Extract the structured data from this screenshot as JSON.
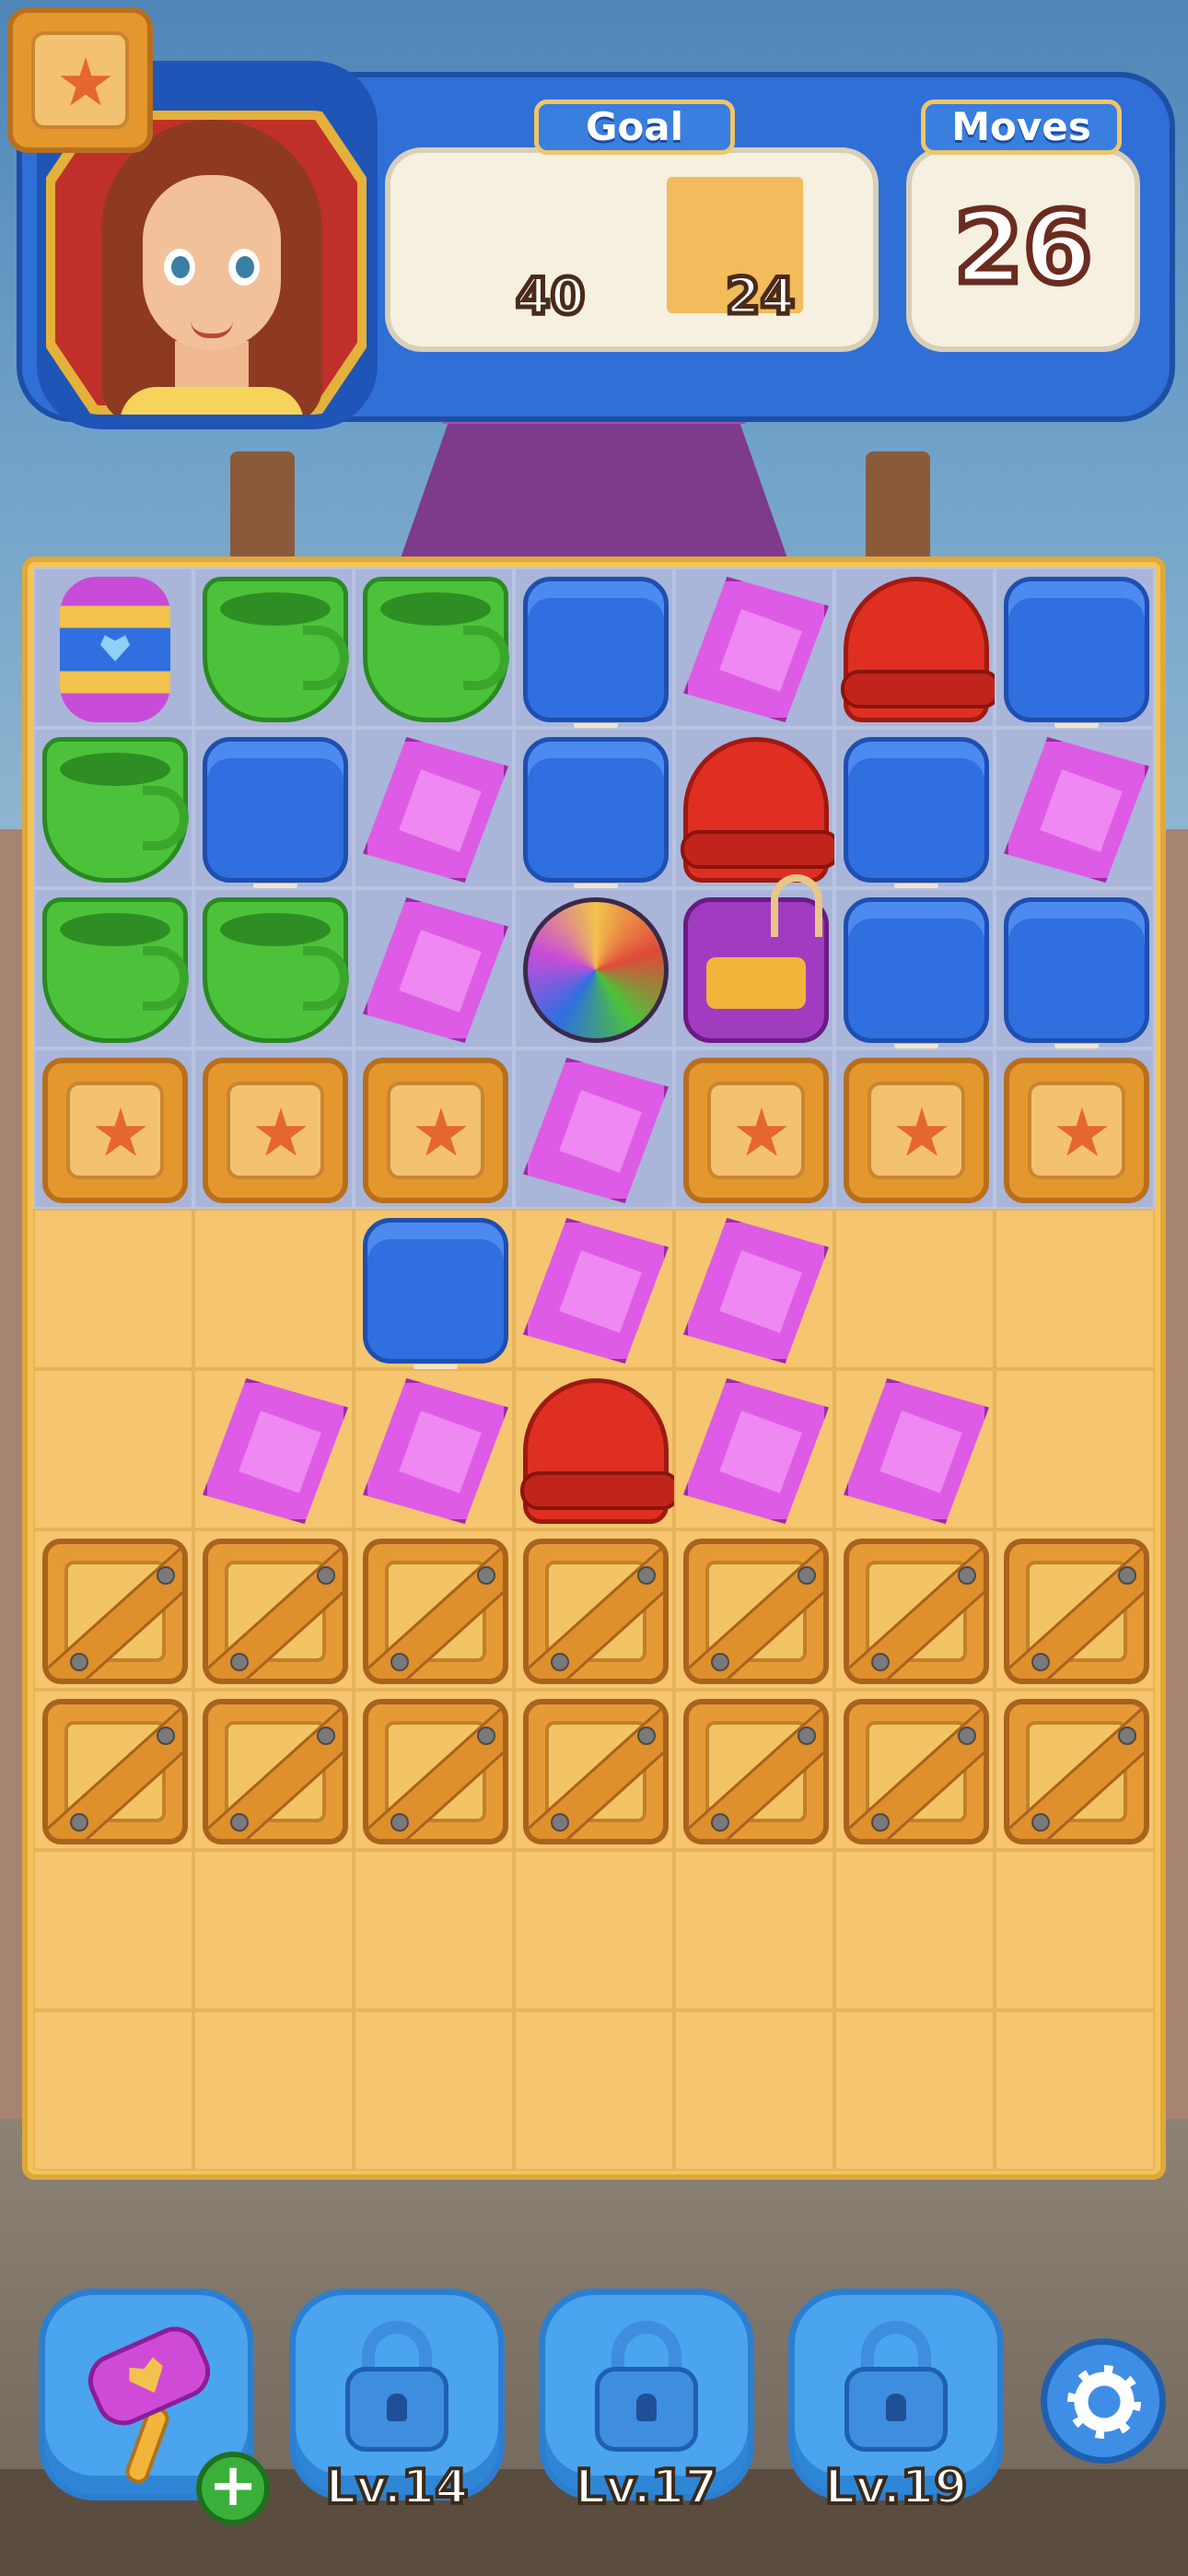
{
  "hud": {
    "goal_label": "Goal",
    "moves_label": "Moves",
    "moves_remaining": "26",
    "goals": [
      {
        "icon": "star-crate-icon",
        "count": "40"
      },
      {
        "icon": "sand-tile-icon",
        "count": "24"
      }
    ]
  },
  "board": {
    "columns": 7,
    "rows": 10,
    "grid": [
      [
        "spinner",
        "cup",
        "cup",
        "jelly",
        "gem",
        "hat",
        "jelly"
      ],
      [
        "cup",
        "jelly",
        "gem",
        "jelly",
        "hat",
        "jelly",
        "gem"
      ],
      [
        "cup",
        "cup",
        "gem",
        "ball",
        "jar",
        "jelly",
        "jelly"
      ],
      [
        "crate",
        "crate",
        "crate",
        "gem",
        "crate",
        "crate",
        "crate"
      ],
      [
        "sand",
        "sand",
        "jelly",
        "gem",
        "gem",
        "sand",
        "sand"
      ],
      [
        "sand",
        "gem",
        "gem",
        "hat",
        "gem",
        "gem",
        "sand"
      ],
      [
        "plank",
        "plank",
        "plank",
        "plank",
        "plank",
        "plank",
        "plank"
      ],
      [
        "plank",
        "plank",
        "plank",
        "plank",
        "plank",
        "plank",
        "plank"
      ],
      [
        "sand",
        "sand",
        "sand",
        "sand",
        "sand",
        "sand",
        "sand"
      ],
      [
        "sand",
        "sand",
        "sand",
        "sand",
        "sand",
        "sand",
        "sand"
      ]
    ],
    "tile_backgrounds": [
      [
        "b",
        "b",
        "b",
        "b",
        "b",
        "b",
        "b"
      ],
      [
        "b",
        "b",
        "b",
        "b",
        "b",
        "b",
        "b"
      ],
      [
        "b",
        "b",
        "b",
        "b",
        "b",
        "b",
        "b"
      ],
      [
        "b",
        "b",
        "b",
        "b",
        "b",
        "b",
        "b"
      ],
      [
        "s",
        "s",
        "s",
        "s",
        "s",
        "s",
        "s"
      ],
      [
        "s",
        "s",
        "s",
        "s",
        "s",
        "s",
        "s"
      ],
      [
        "s",
        "s",
        "s",
        "s",
        "s",
        "s",
        "s"
      ],
      [
        "s",
        "s",
        "s",
        "s",
        "s",
        "s",
        "s"
      ],
      [
        "s",
        "s",
        "s",
        "s",
        "s",
        "s",
        "s"
      ],
      [
        "s",
        "s",
        "s",
        "s",
        "s",
        "s",
        "s"
      ]
    ]
  },
  "boosters": [
    {
      "name": "hammer",
      "icon": "hammer-icon",
      "unlocked": true,
      "add_label": "+"
    },
    {
      "name": "locked-1",
      "icon": "lock-icon",
      "unlocked": false,
      "level_label": "Lv.14"
    },
    {
      "name": "locked-2",
      "icon": "lock-icon",
      "unlocked": false,
      "level_label": "Lv.17"
    },
    {
      "name": "locked-3",
      "icon": "lock-icon",
      "unlocked": false,
      "level_label": "Lv.19"
    }
  ],
  "settings": {
    "icon": "gear-icon"
  },
  "colors": {
    "header_blue": "#2f6fd6",
    "board_frame": "#f3c45a",
    "sand": "#f5c56f",
    "jelly_blue": "#2f6fe0",
    "gem_pink": "#de5be6",
    "cup_green": "#4cc23a",
    "hat_red": "#de2f22"
  }
}
